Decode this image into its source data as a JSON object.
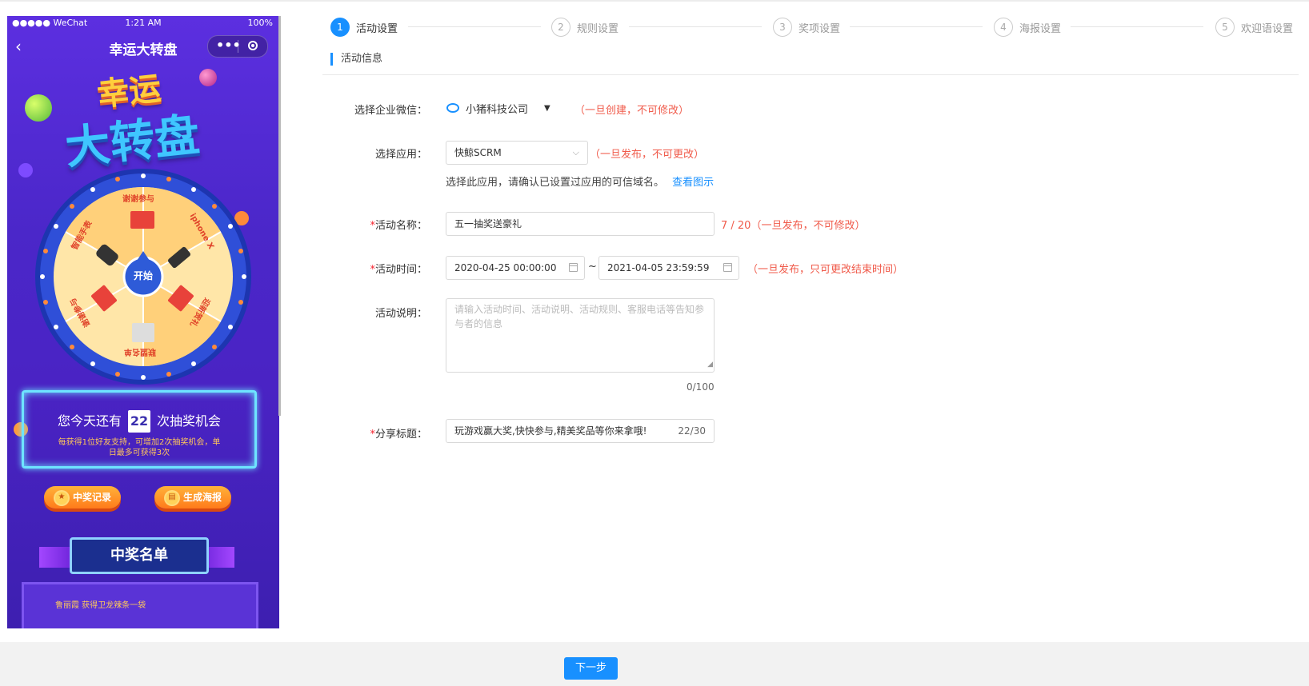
{
  "phone": {
    "status_left": "●●●●● WeChat",
    "status_time": "1:21 AM",
    "status_battery": "100%",
    "nav_title": "幸运大转盘",
    "big_title_line1": "幸运",
    "big_title_line2": "大转盘",
    "wheel_segments": [
      "谢谢参与",
      "iphone X",
      "迎新贺礼",
      "联盟名单",
      "谢谢参与",
      "智能手表"
    ],
    "wheel_center": "开始",
    "chance_prefix": "您今天还有",
    "chance_count": "22",
    "chance_suffix": "次抽奖机会",
    "chance_note": "每获得1位好友支持，可增加2次抽奖机会，单日最多可获得3次",
    "btn_records": "中奖记录",
    "btn_poster": "生成海报",
    "winners_title": "中奖名单",
    "winners_row": "鲁丽霞     获得卫龙辣条一袋"
  },
  "steps": [
    {
      "num": "1",
      "label": "活动设置"
    },
    {
      "num": "2",
      "label": "规则设置"
    },
    {
      "num": "3",
      "label": "奖项设置"
    },
    {
      "num": "4",
      "label": "海报设置"
    },
    {
      "num": "5",
      "label": "欢迎语设置"
    }
  ],
  "section_title": "活动信息",
  "form": {
    "corp_label": "选择企业微信：",
    "corp_value": "小猪科技公司",
    "corp_note": "（一旦创建，不可修改）",
    "app_label": "选择应用：",
    "app_value": "快鲸SCRM",
    "app_note": "（一旦发布，不可更改）",
    "app_hint": "选择此应用，请确认已设置过应用的可信域名。",
    "app_hint_link": "查看图示",
    "name_label": "活动名称：",
    "name_value": "五一抽奖送豪礼",
    "name_note": "7 / 20（一旦发布，不可修改）",
    "time_label": "活动时间：",
    "time_start": "2020-04-25 00:00:00",
    "time_sep": "~",
    "time_end": "2021-04-05 23:59:59",
    "time_note": "（一旦发布，只可更改结束时间）",
    "desc_label": "活动说明：",
    "desc_placeholder": "请输入活动时间、活动说明、活动规则、客服电话等告知参与者的信息",
    "desc_count": "0/100",
    "share_label": "分享标题：",
    "share_value": "玩游戏赢大奖,快快参与,精美奖品等你来拿哦!",
    "share_count": "22/30",
    "required_mark": "*"
  },
  "footer": {
    "next_label": "下一步"
  },
  "colors": {
    "primary": "#1890ff",
    "warn": "#f05a4a",
    "phone_bg": "#4b27c9"
  }
}
